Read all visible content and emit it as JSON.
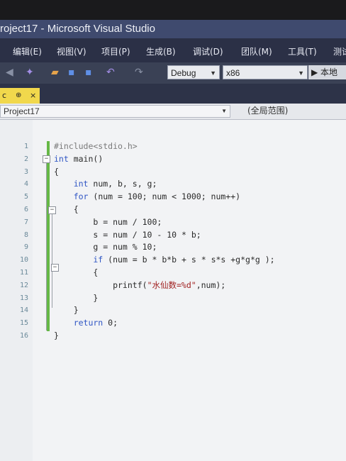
{
  "window": {
    "title": "roject17 - Microsoft Visual Studio"
  },
  "menu": [
    "编辑(E)",
    "视图(V)",
    "项目(P)",
    "生成(B)",
    "调试(D)",
    "团队(M)",
    "工具(T)",
    "测试"
  ],
  "toolbar": {
    "config": "Debug",
    "platform": "x86",
    "start_label": "▶ 本地"
  },
  "tab": {
    "label": "c",
    "pin": "⊕",
    "close": "×"
  },
  "navbar": {
    "project": "Project17",
    "scope": "(全局范围)"
  },
  "editor": {
    "lines": [
      {
        "n": "1",
        "parts": [
          {
            "t": "#include<stdio.h>",
            "c": "pp"
          }
        ]
      },
      {
        "n": "2",
        "parts": [
          {
            "t": "int",
            "c": "kw"
          },
          {
            "t": " main()",
            "c": "plain"
          }
        ]
      },
      {
        "n": "3",
        "parts": [
          {
            "t": "{",
            "c": "plain"
          }
        ]
      },
      {
        "n": "4",
        "parts": [
          {
            "t": "    int",
            "c": "kw"
          },
          {
            "t": " num, b, s, g;",
            "c": "plain"
          }
        ]
      },
      {
        "n": "5",
        "parts": [
          {
            "t": "    for",
            "c": "kw"
          },
          {
            "t": " (num = 100; num < 1000; num++)",
            "c": "plain"
          }
        ]
      },
      {
        "n": "6",
        "parts": [
          {
            "t": "    {",
            "c": "plain"
          }
        ]
      },
      {
        "n": "7",
        "parts": [
          {
            "t": "        b = num / 100;",
            "c": "plain"
          }
        ]
      },
      {
        "n": "8",
        "parts": [
          {
            "t": "        s = num / 10 - 10 * b;",
            "c": "plain"
          }
        ]
      },
      {
        "n": "9",
        "parts": [
          {
            "t": "        g = num % 10;",
            "c": "plain"
          }
        ]
      },
      {
        "n": "10",
        "parts": [
          {
            "t": "        if",
            "c": "kw"
          },
          {
            "t": " (num = b * b*b + s * s*s +g*g*g );",
            "c": "plain"
          }
        ]
      },
      {
        "n": "11",
        "parts": [
          {
            "t": "        {",
            "c": "plain"
          }
        ]
      },
      {
        "n": "12",
        "parts": [
          {
            "t": "            printf(",
            "c": "plain"
          },
          {
            "t": "\"水仙数=%d\"",
            "c": "str"
          },
          {
            "t": ",num);",
            "c": "plain"
          }
        ]
      },
      {
        "n": "13",
        "parts": [
          {
            "t": "        }",
            "c": "plain"
          }
        ]
      },
      {
        "n": "14",
        "parts": [
          {
            "t": "    }",
            "c": "plain"
          }
        ]
      },
      {
        "n": "15",
        "parts": [
          {
            "t": "    return",
            "c": "kw"
          },
          {
            "t": " 0;",
            "c": "plain"
          }
        ]
      },
      {
        "n": "16",
        "parts": [
          {
            "t": "}",
            "c": "plain"
          }
        ]
      }
    ]
  }
}
